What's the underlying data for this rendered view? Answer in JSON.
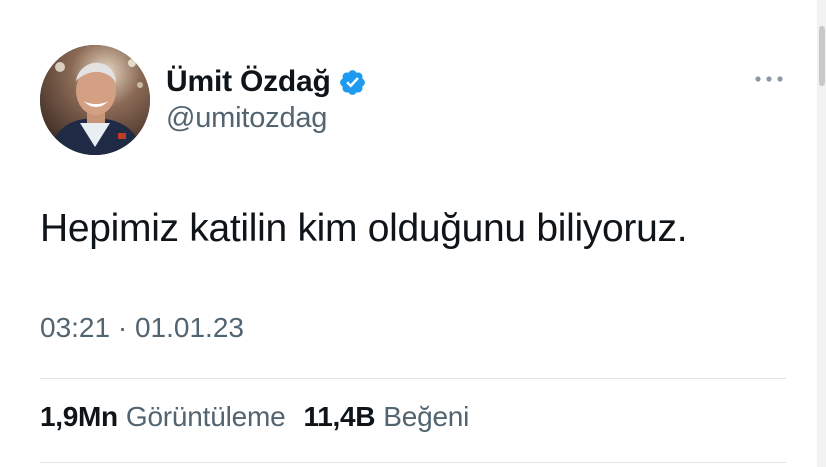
{
  "author": {
    "display_name": "Ümit Özdağ",
    "handle": "@umitozdag",
    "verified": true,
    "avatar_icon": "profile-photo",
    "verified_icon": "verified-badge-icon",
    "verified_color": "#1d9bf0"
  },
  "tweet": {
    "text": "Hepimiz katilin kim olduğunu biliyoruz.",
    "time": "03:21",
    "separator": "·",
    "date": "01.01.23"
  },
  "stats": {
    "views_value": "1,9Mn",
    "views_label": "Görüntüleme",
    "likes_value": "11,4B",
    "likes_label": "Beğeni"
  },
  "menu": {
    "more_icon": "more-horizontal-icon"
  },
  "colors": {
    "text_primary": "#0f1419",
    "text_secondary": "#536471",
    "divider": "#dfe3e6"
  }
}
